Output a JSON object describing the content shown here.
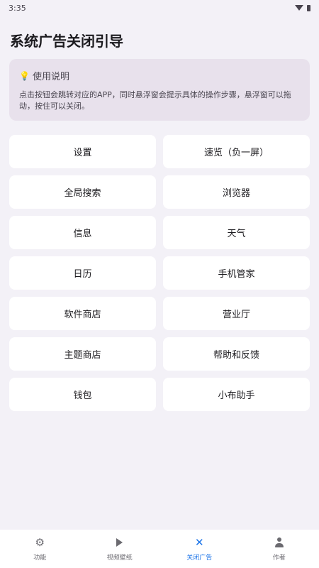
{
  "status_bar": {
    "time": "3:35"
  },
  "page": {
    "title": "系统广告关闭引导"
  },
  "info": {
    "icon": "lightbulb-icon",
    "title": "使用说明",
    "text": "点击按钮会跳转对应的APP，同时悬浮窗会提示具体的操作步骤，悬浮窗可以拖动，按住可以关闭。"
  },
  "buttons": [
    {
      "label": "设置"
    },
    {
      "label": "速览（负一屏）"
    },
    {
      "label": "全局搜索"
    },
    {
      "label": "浏览器"
    },
    {
      "label": "信息"
    },
    {
      "label": "天气"
    },
    {
      "label": "日历"
    },
    {
      "label": "手机管家"
    },
    {
      "label": "软件商店"
    },
    {
      "label": "营业厅"
    },
    {
      "label": "主题商店"
    },
    {
      "label": "帮助和反馈"
    },
    {
      "label": "钱包"
    },
    {
      "label": "小布助手"
    }
  ],
  "bottom_nav": {
    "active_color": "#1a73e8",
    "items": [
      {
        "label": "功能",
        "icon": "gear-icon"
      },
      {
        "label": "视频壁纸",
        "icon": "play-icon"
      },
      {
        "label": "关闭广告",
        "icon": "close-icon",
        "active": true
      },
      {
        "label": "作者",
        "icon": "person-icon"
      }
    ]
  }
}
